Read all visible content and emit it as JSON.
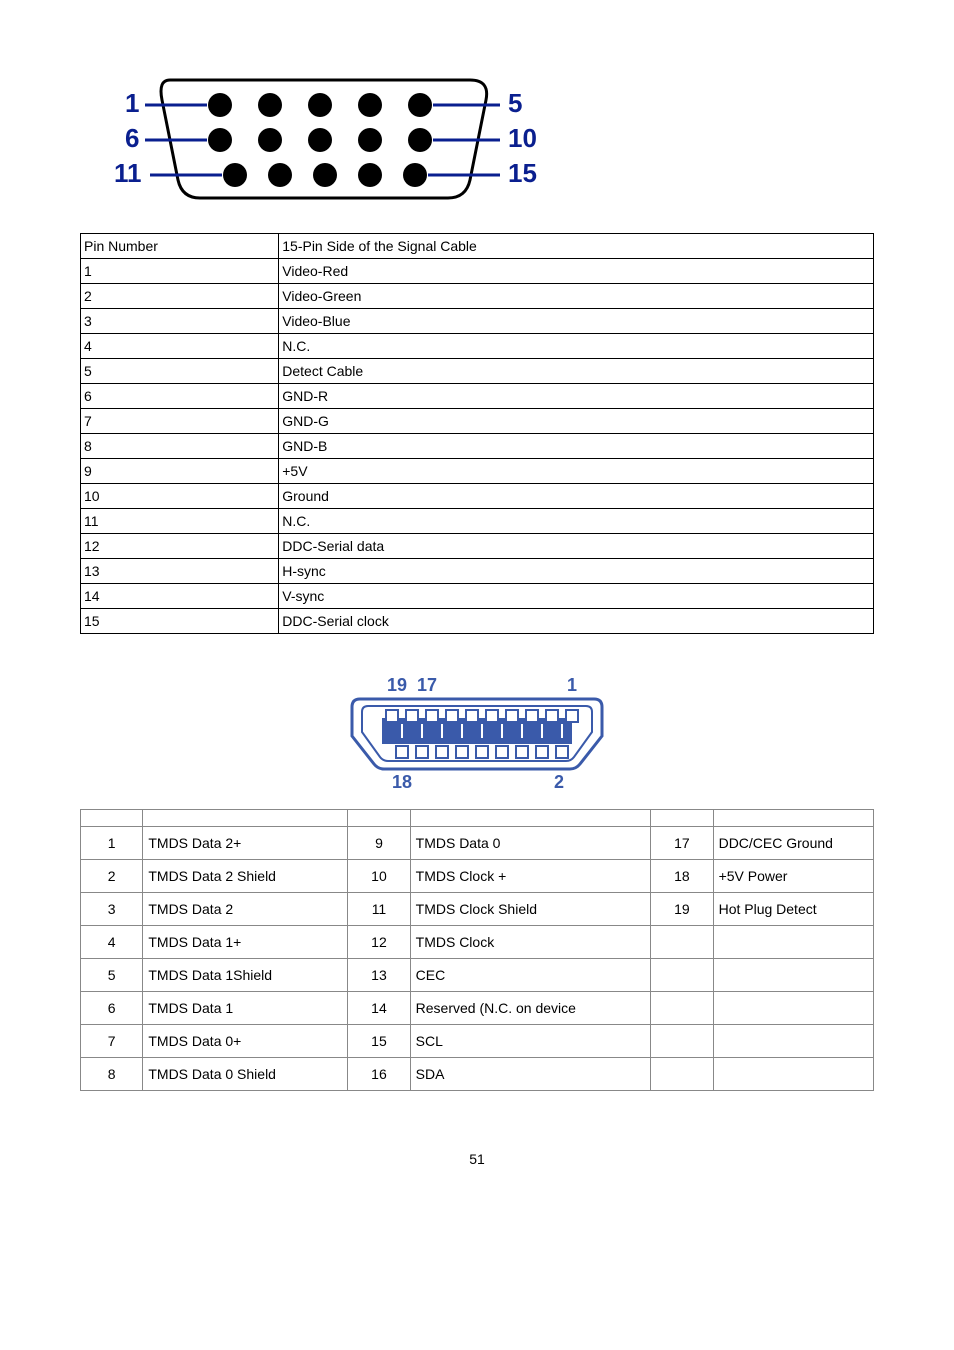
{
  "vga_table": {
    "header": {
      "pin": "Pin Number",
      "desc": "15-Pin Side of the Signal Cable"
    },
    "rows": [
      {
        "pin": "1",
        "desc": "Video-Red"
      },
      {
        "pin": "2",
        "desc": "Video-Green"
      },
      {
        "pin": "3",
        "desc": "Video-Blue"
      },
      {
        "pin": "4",
        "desc": "N.C."
      },
      {
        "pin": "5",
        "desc": "Detect Cable"
      },
      {
        "pin": "6",
        "desc": "GND-R"
      },
      {
        "pin": "7",
        "desc": "GND-G"
      },
      {
        "pin": "8",
        "desc": "GND-B"
      },
      {
        "pin": "9",
        "desc": "+5V"
      },
      {
        "pin": "10",
        "desc": "Ground"
      },
      {
        "pin": "11",
        "desc": "N.C."
      },
      {
        "pin": "12",
        "desc": "DDC-Serial data"
      },
      {
        "pin": "13",
        "desc": "H-sync"
      },
      {
        "pin": "14",
        "desc": "V-sync"
      },
      {
        "pin": "15",
        "desc": "DDC-Serial clock"
      }
    ]
  },
  "vga_diagram": {
    "labels": {
      "l1": "1",
      "l6": "6",
      "l11": "11",
      "l5": "5",
      "l10": "10",
      "l15": "15"
    }
  },
  "hdmi_diagram": {
    "labels": {
      "t19": "19",
      "t17": "17",
      "t1": "1",
      "b18": "18",
      "b2": "2"
    }
  },
  "hdmi_table": {
    "rows": [
      {
        "n1": "1",
        "d1": "TMDS Data 2+",
        "n2": "9",
        "d2": "TMDS Data 0",
        "n3": "17",
        "d3": "DDC/CEC Ground"
      },
      {
        "n1": "2",
        "d1": "TMDS Data 2 Shield",
        "n2": "10",
        "d2": "TMDS Clock +",
        "n3": "18",
        "d3": "+5V Power"
      },
      {
        "n1": "3",
        "d1": "TMDS Data 2",
        "n2": "11",
        "d2": "TMDS Clock Shield",
        "n3": "19",
        "d3": "Hot Plug Detect"
      },
      {
        "n1": "4",
        "d1": "TMDS Data 1+",
        "n2": "12",
        "d2": "TMDS Clock",
        "n3": "",
        "d3": ""
      },
      {
        "n1": "5",
        "d1": "TMDS Data 1Shield",
        "n2": "13",
        "d2": "CEC",
        "n3": "",
        "d3": ""
      },
      {
        "n1": "6",
        "d1": "TMDS Data 1",
        "n2": "14",
        "d2": "Reserved (N.C. on device",
        "n3": "",
        "d3": ""
      },
      {
        "n1": "7",
        "d1": "TMDS Data 0+",
        "n2": "15",
        "d2": "SCL",
        "n3": "",
        "d3": ""
      },
      {
        "n1": "8",
        "d1": "TMDS Data 0 Shield",
        "n2": "16",
        "d2": "SDA",
        "n3": "",
        "d3": ""
      }
    ]
  },
  "page_number": "51"
}
